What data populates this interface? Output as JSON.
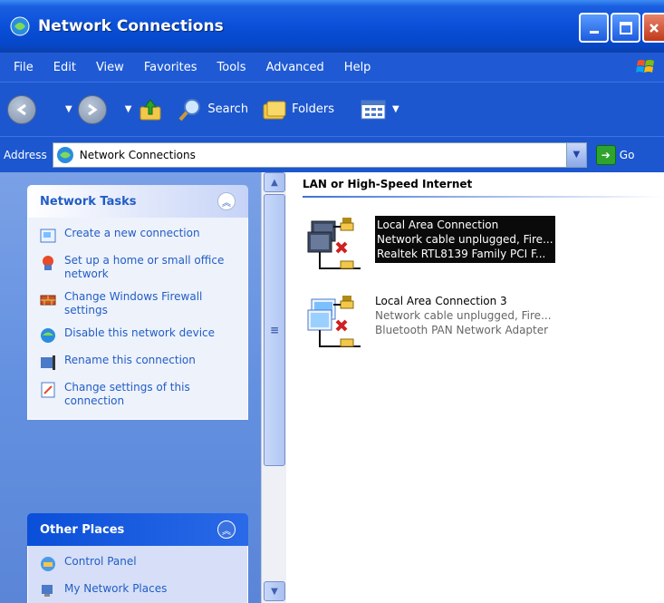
{
  "window": {
    "title": "Network Connections"
  },
  "menu": [
    "File",
    "Edit",
    "View",
    "Favorites",
    "Tools",
    "Advanced",
    "Help"
  ],
  "toolbar": {
    "search": "Search",
    "folders": "Folders"
  },
  "address": {
    "label": "Address",
    "value": "Network Connections",
    "go": "Go"
  },
  "network_tasks": {
    "title": "Network Tasks",
    "items": [
      "Create a new connection",
      "Set up a home or small office network",
      "Change Windows Firewall settings",
      "Disable this network device",
      "Rename this connection",
      "Change settings of this connection"
    ]
  },
  "other_places": {
    "title": "Other Places",
    "items": [
      "Control Panel",
      "My Network Places"
    ]
  },
  "content": {
    "group": "LAN or High-Speed Internet",
    "connections": [
      {
        "name": "Local Area Connection",
        "status": "Network cable unplugged, Fire...",
        "device": "Realtek RTL8139 Family PCI F..."
      },
      {
        "name": "Local Area Connection 3",
        "status": "Network cable unplugged, Fire...",
        "device": "Bluetooth PAN Network Adapter"
      }
    ]
  },
  "colors": {
    "title_blue": "#0a4fd8",
    "task_text": "#215dc6",
    "selection": "#0a0a0a"
  }
}
